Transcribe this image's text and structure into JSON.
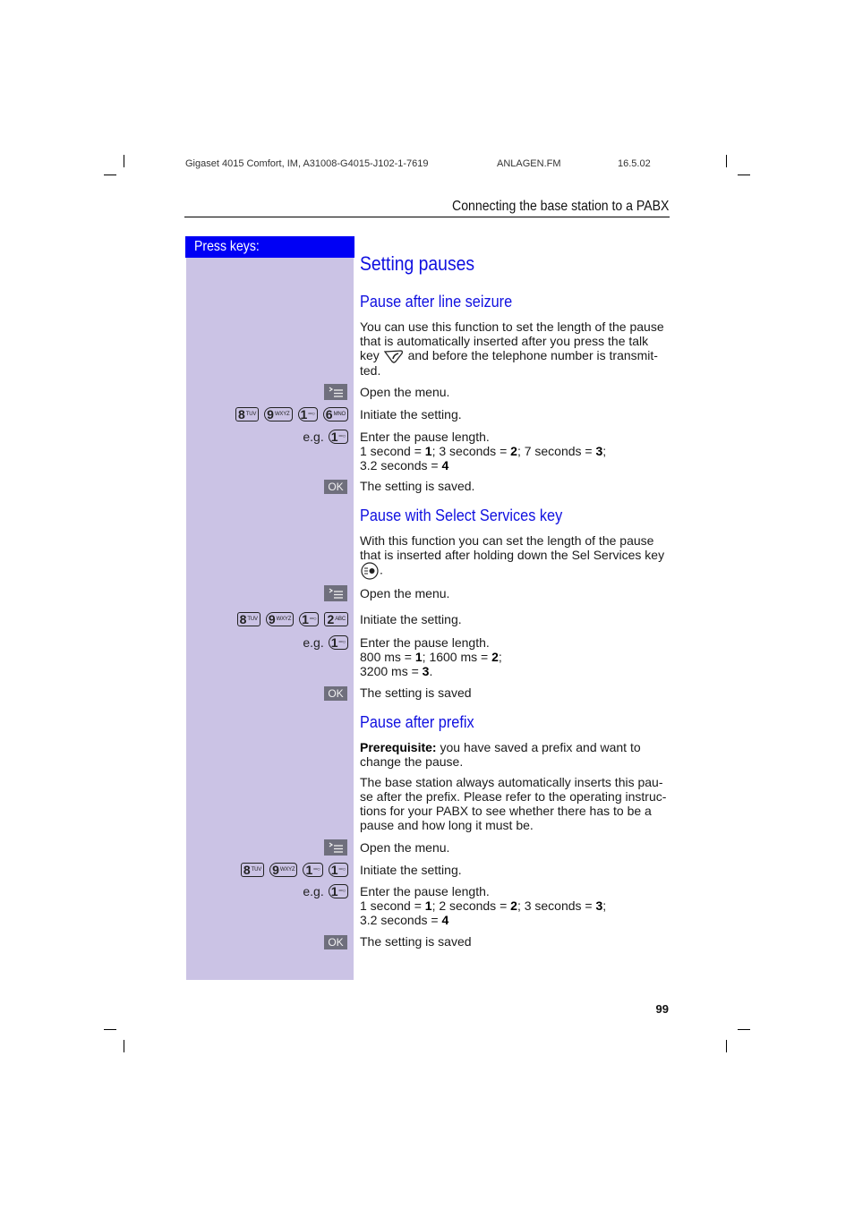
{
  "header": {
    "doc_id": "Gigaset 4015 Comfort, IM, A31008-G4015-J102-1-7619",
    "file": "ANLAGEN.FM",
    "date": "16.5.02",
    "running_title": "Connecting the base station to a PABX"
  },
  "left_column": {
    "title": "Press keys:"
  },
  "page_title": "Setting pauses",
  "sections": [
    {
      "heading": "Pause after line seizure",
      "intro_lines": [
        "You can use this function to set the length of the pause",
        "that is automatically inserted after you press the talk",
        "key",
        "and before the telephone number is transmit-",
        "ted."
      ],
      "steps": [
        {
          "keys": "menu-key",
          "text": "Open the menu."
        },
        {
          "keys": [
            {
              "digit": "8",
              "letters": "TUV"
            },
            {
              "digit": "9",
              "letters": "WXYZ"
            },
            {
              "digit": "1",
              "letters": "═○"
            },
            {
              "digit": "6",
              "letters": "MNO"
            }
          ],
          "text": "Initiate the setting."
        },
        {
          "eg_label": "e.g.",
          "eg_key": {
            "digit": "1",
            "letters": "═○"
          },
          "text": "Enter the pause length.",
          "values_line1": [
            "1 second = ",
            "1",
            "; 3 seconds = ",
            "2",
            "; 7 seconds = ",
            "3",
            ";"
          ],
          "values_line2": [
            "3.2 seconds = ",
            "4",
            ""
          ]
        },
        {
          "keys": "OK",
          "text": "The setting is saved."
        }
      ]
    },
    {
      "heading": "Pause with Select Services key",
      "intro_lines": [
        "With this function you can set the length of the pause",
        "that is inserted after holding down the Sel Services key",
        "."
      ],
      "steps": [
        {
          "keys": "menu-key",
          "text": "Open the menu."
        },
        {
          "keys": [
            {
              "digit": "8",
              "letters": "TUV"
            },
            {
              "digit": "9",
              "letters": "WXYZ"
            },
            {
              "digit": "1",
              "letters": "═○"
            },
            {
              "digit": "2",
              "letters": "ABC"
            }
          ],
          "text": "Initiate the setting."
        },
        {
          "eg_label": "e.g.",
          "eg_key": {
            "digit": "1",
            "letters": "═○"
          },
          "text": "Enter the pause length.",
          "values_line1": [
            "800 ms = ",
            "1",
            "; 1600 ms = ",
            "2",
            ";"
          ],
          "values_line2": [
            "3200 ms = ",
            "3",
            "."
          ]
        },
        {
          "keys": "OK",
          "text": "The setting is saved"
        }
      ]
    },
    {
      "heading": "Pause after prefix",
      "prerequisite_label": "Prerequisite:",
      "prerequisite_lines": [
        " you have saved a prefix and want to",
        "change the pause."
      ],
      "body_lines": [
        "The base station always automatically inserts this pau-",
        "se after the prefix. Please refer to the operating instruc-",
        "tions for your PABX to see whether there has to be a",
        "pause and how long it must be."
      ],
      "steps": [
        {
          "keys": "menu-key",
          "text": "Open the menu."
        },
        {
          "keys": [
            {
              "digit": "8",
              "letters": "TUV"
            },
            {
              "digit": "9",
              "letters": "WXYZ"
            },
            {
              "digit": "1",
              "letters": "═○"
            },
            {
              "digit": "1",
              "letters": "═○"
            }
          ],
          "text": "Initiate the setting."
        },
        {
          "eg_label": "e.g.",
          "eg_key": {
            "digit": "1",
            "letters": "═○"
          },
          "text": "Enter the pause length.",
          "values_line1": [
            "1 second = ",
            "1",
            "; 2 seconds = ",
            "2",
            "; 3 seconds = ",
            "3",
            ";"
          ],
          "values_line2": [
            "3.2 seconds = ",
            "4",
            ""
          ]
        },
        {
          "keys": "OK",
          "text": "The setting is saved"
        }
      ]
    }
  ],
  "ok_label": "OK",
  "page_number": "99",
  "colors": {
    "heading_blue": "#1010e0",
    "press_keys_bg": "#0000f5",
    "left_column_bg": "#cbc3e5",
    "softkey_bg": "#6f6f7d"
  }
}
